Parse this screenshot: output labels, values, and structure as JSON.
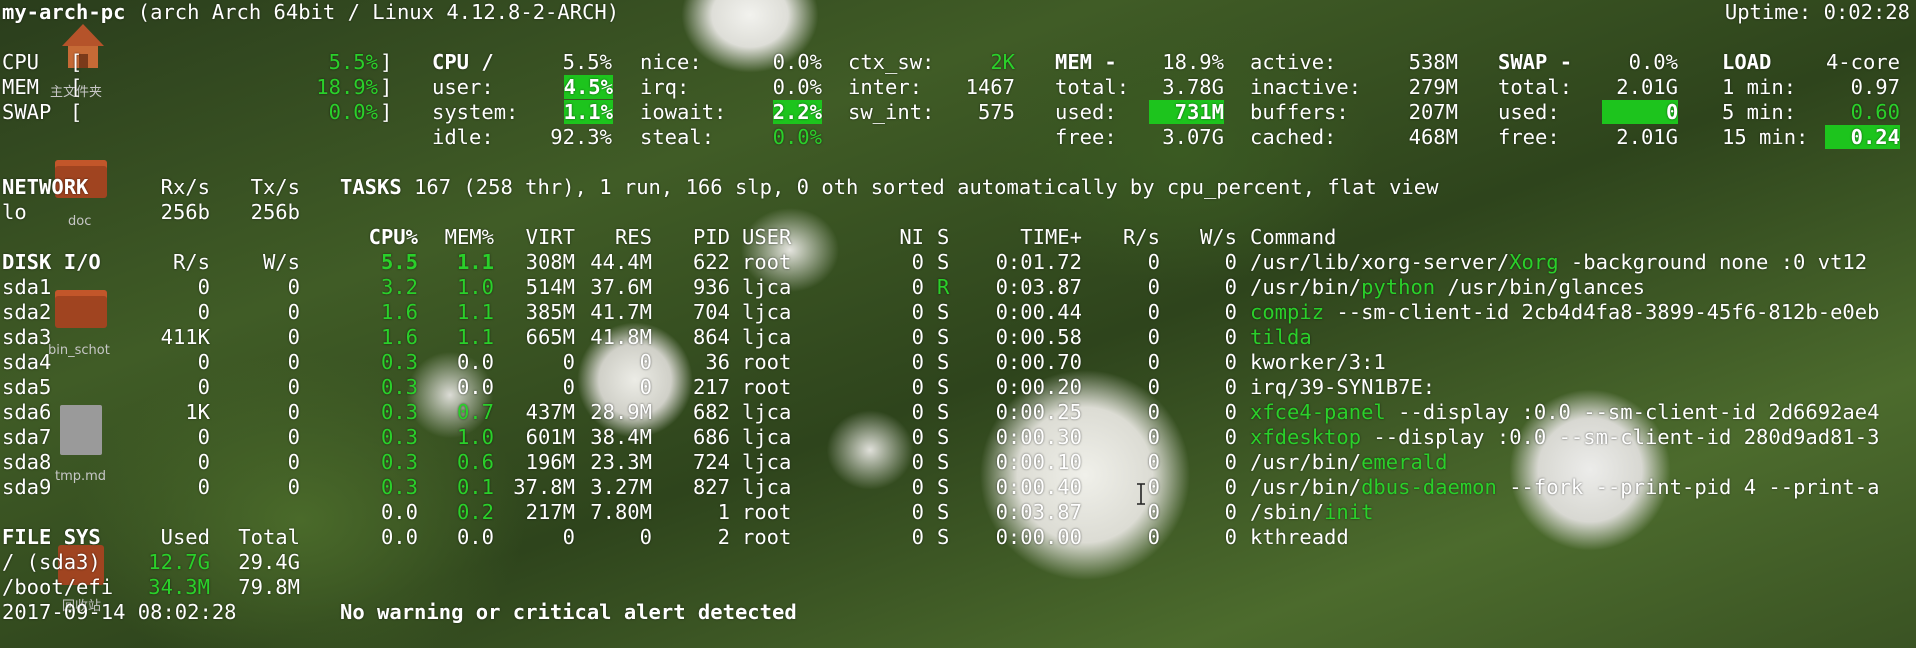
{
  "header": {
    "hostname": "my-arch-pc",
    "system": "(arch Arch 64bit / Linux 4.12.8-2-ARCH)",
    "uptime": "Uptime: 0:02:28"
  },
  "quicklook": {
    "cpu": {
      "label": "CPU",
      "value": "5.5%"
    },
    "mem": {
      "label": "MEM",
      "value": "18.9%"
    },
    "swap": {
      "label": "SWAP",
      "value": "0.0%"
    }
  },
  "cpu": {
    "title": "CPU /",
    "total": "5.5%",
    "rows": [
      {
        "k": "user:",
        "v": "4.5%"
      },
      {
        "k": "system:",
        "v": "1.1%"
      },
      {
        "k": "idle:",
        "v": "92.3%"
      }
    ],
    "rows2": [
      {
        "k": "nice:",
        "v": "0.0%"
      },
      {
        "k": "irq:",
        "v": "0.0%"
      },
      {
        "k": "iowait:",
        "v": "2.2%"
      },
      {
        "k": "steal:",
        "v": "0.0%"
      }
    ],
    "rows3": [
      {
        "k": "ctx_sw:",
        "v": "2K"
      },
      {
        "k": "inter:",
        "v": "1467"
      },
      {
        "k": "sw_int:",
        "v": "575"
      }
    ]
  },
  "mem": {
    "title": "MEM -",
    "total_pct": "18.9%",
    "rows": [
      {
        "k": "total:",
        "v": "3.78G"
      },
      {
        "k": "used:",
        "v": "731M"
      },
      {
        "k": "free:",
        "v": "3.07G"
      }
    ],
    "rows2": [
      {
        "k": "active:",
        "v": "538M"
      },
      {
        "k": "inactive:",
        "v": "279M"
      },
      {
        "k": "buffers:",
        "v": "207M"
      },
      {
        "k": "cached:",
        "v": "468M"
      }
    ]
  },
  "swap": {
    "title": "SWAP -",
    "total_pct": "0.0%",
    "rows": [
      {
        "k": "total:",
        "v": "2.01G"
      },
      {
        "k": "used:",
        "v": "0"
      },
      {
        "k": "free:",
        "v": "2.01G"
      }
    ]
  },
  "load": {
    "title": "LOAD",
    "cores": "4-core",
    "rows": [
      {
        "k": "1 min:",
        "v": "0.97"
      },
      {
        "k": "5 min:",
        "v": "0.60"
      },
      {
        "k": "15 min:",
        "v": "0.24"
      }
    ]
  },
  "network": {
    "title": "NETWORK",
    "rx": "Rx/s",
    "tx": "Tx/s",
    "rows": [
      {
        "name": "lo",
        "rx": "256b",
        "tx": "256b"
      }
    ]
  },
  "disk": {
    "title": "DISK I/O",
    "r": "R/s",
    "w": "W/s",
    "rows": [
      {
        "name": "sda1",
        "r": "0",
        "w": "0"
      },
      {
        "name": "sda2",
        "r": "0",
        "w": "0"
      },
      {
        "name": "sda3",
        "r": "411K",
        "w": "0"
      },
      {
        "name": "sda4",
        "r": "0",
        "w": "0"
      },
      {
        "name": "sda5",
        "r": "0",
        "w": "0"
      },
      {
        "name": "sda6",
        "r": "1K",
        "w": "0"
      },
      {
        "name": "sda7",
        "r": "0",
        "w": "0"
      },
      {
        "name": "sda8",
        "r": "0",
        "w": "0"
      },
      {
        "name": "sda9",
        "r": "0",
        "w": "0"
      }
    ]
  },
  "fs": {
    "title": "FILE SYS",
    "used": "Used",
    "total": "Total",
    "rows": [
      {
        "name": "/ (sda3)",
        "used": "12.7G",
        "total": "29.4G"
      },
      {
        "name": "/boot/efi",
        "used": "34.3M",
        "total": "79.8M"
      }
    ]
  },
  "footer": {
    "datetime": "2017-09-14 08:02:28",
    "alert": "No warning or critical alert detected"
  },
  "tasks": {
    "title": "TASKS",
    "summary": "167 (258 thr), 1 run, 166 slp, 0 oth sorted automatically by cpu_percent, flat view",
    "headers": {
      "cpu": "CPU%",
      "mem": "MEM%",
      "virt": "VIRT",
      "res": "RES",
      "pid": "PID",
      "user": "USER",
      "ni": "NI",
      "s": "S",
      "time": "TIME+",
      "rs": "R/s",
      "ws": "W/s",
      "cmd": "Command"
    },
    "rows": [
      {
        "cpu": "5.5",
        "mem": "1.1",
        "virt": "308M",
        "res": "44.4M",
        "pid": "622",
        "user": "root",
        "ni": "0",
        "s": "S",
        "time": "0:01.72",
        "rs": "0",
        "ws": "0",
        "cmd_a": "/usr/lib/xorg-server/",
        "cmd_g": "Xorg",
        "cmd_b": " -background none :0 vt12"
      },
      {
        "cpu": "3.2",
        "mem": "1.0",
        "virt": "514M",
        "res": "37.6M",
        "pid": "936",
        "user": "ljca",
        "ni": "0",
        "s": "R",
        "time": "0:03.87",
        "rs": "0",
        "ws": "0",
        "cmd_a": "/usr/bin/",
        "cmd_g": "python",
        "cmd_b": " /usr/bin/glances"
      },
      {
        "cpu": "1.6",
        "mem": "1.1",
        "virt": "385M",
        "res": "41.7M",
        "pid": "704",
        "user": "ljca",
        "ni": "0",
        "s": "S",
        "time": "0:00.44",
        "rs": "0",
        "ws": "0",
        "cmd_a": "",
        "cmd_g": "compiz",
        "cmd_b": " --sm-client-id 2cb4d4fa8-3899-45f6-812b-e0eb"
      },
      {
        "cpu": "1.6",
        "mem": "1.1",
        "virt": "665M",
        "res": "41.8M",
        "pid": "864",
        "user": "ljca",
        "ni": "0",
        "s": "S",
        "time": "0:00.58",
        "rs": "0",
        "ws": "0",
        "cmd_a": "",
        "cmd_g": "tilda",
        "cmd_b": ""
      },
      {
        "cpu": "0.3",
        "mem": "0.0",
        "virt": "0",
        "res": "0",
        "pid": "36",
        "user": "root",
        "ni": "0",
        "s": "S",
        "time": "0:00.70",
        "rs": "0",
        "ws": "0",
        "cmd_a": "kworker/3:1",
        "cmd_g": "",
        "cmd_b": ""
      },
      {
        "cpu": "0.3",
        "mem": "0.0",
        "virt": "0",
        "res": "0",
        "pid": "217",
        "user": "root",
        "ni": "0",
        "s": "S",
        "time": "0:00.20",
        "rs": "0",
        "ws": "0",
        "cmd_a": "irq/39-SYN1B7E:",
        "cmd_g": "",
        "cmd_b": ""
      },
      {
        "cpu": "0.3",
        "mem": "0.7",
        "virt": "437M",
        "res": "28.9M",
        "pid": "682",
        "user": "ljca",
        "ni": "0",
        "s": "S",
        "time": "0:00.25",
        "rs": "0",
        "ws": "0",
        "cmd_a": "",
        "cmd_g": "xfce4-panel",
        "cmd_b": " --display :0.0 --sm-client-id 2d6692ae4"
      },
      {
        "cpu": "0.3",
        "mem": "1.0",
        "virt": "601M",
        "res": "38.4M",
        "pid": "686",
        "user": "ljca",
        "ni": "0",
        "s": "S",
        "time": "0:00.30",
        "rs": "0",
        "ws": "0",
        "cmd_a": "",
        "cmd_g": "xfdesktop",
        "cmd_b": " --display :0.0 --sm-client-id 280d9ad81-3"
      },
      {
        "cpu": "0.3",
        "mem": "0.6",
        "virt": "196M",
        "res": "23.3M",
        "pid": "724",
        "user": "ljca",
        "ni": "0",
        "s": "S",
        "time": "0:00.10",
        "rs": "0",
        "ws": "0",
        "cmd_a": "/usr/bin/",
        "cmd_g": "emerald",
        "cmd_b": ""
      },
      {
        "cpu": "0.3",
        "mem": "0.1",
        "virt": "37.8M",
        "res": "3.27M",
        "pid": "827",
        "user": "ljca",
        "ni": "0",
        "s": "S",
        "time": "0:00.40",
        "rs": "0",
        "ws": "0",
        "cmd_a": "/usr/bin/",
        "cmd_g": "dbus-daemon",
        "cmd_b": " --fork --print-pid 4 --print-a"
      },
      {
        "cpu": "0.0",
        "mem": "0.2",
        "virt": "217M",
        "res": "7.80M",
        "pid": "1",
        "user": "root",
        "ni": "0",
        "s": "S",
        "time": "0:03.87",
        "rs": "0",
        "ws": "0",
        "cmd_a": "/sbin/",
        "cmd_g": "init",
        "cmd_b": ""
      },
      {
        "cpu": "0.0",
        "mem": "0.0",
        "virt": "0",
        "res": "0",
        "pid": "2",
        "user": "root",
        "ni": "0",
        "s": "S",
        "time": "0:00.00",
        "rs": "0",
        "ws": "0",
        "cmd_a": "kthreadd",
        "cmd_g": "",
        "cmd_b": ""
      }
    ]
  },
  "desktop_icons": [
    {
      "name": "home-folder",
      "label": "主文件夹"
    },
    {
      "name": "doc-folder",
      "label": "doc"
    },
    {
      "name": "bin-schot-folder",
      "label": "bin_schot"
    },
    {
      "name": "tmp-md-file",
      "label": "tmp.md"
    },
    {
      "name": "trash",
      "label": "回收站"
    }
  ]
}
